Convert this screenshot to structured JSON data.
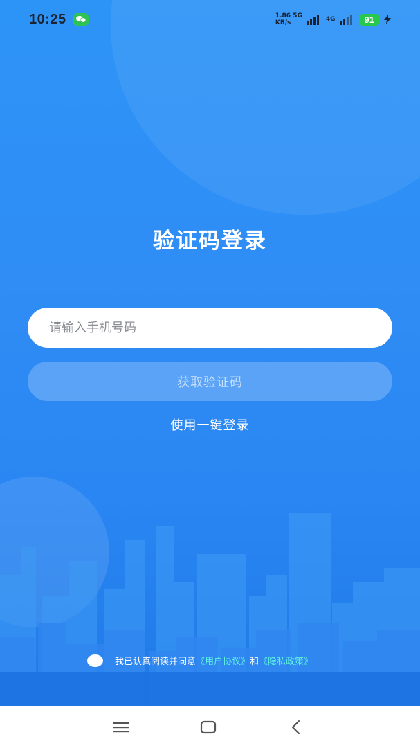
{
  "status_bar": {
    "time": "10:25",
    "net_speed_value": "1.86",
    "net_speed_unit": "KB/s",
    "net_type_1": "5G",
    "net_type_2": "4G",
    "battery": "91"
  },
  "login": {
    "title": "验证码登录",
    "phone_placeholder": "请输入手机号码",
    "get_code_label": "获取验证码",
    "one_key_login_label": "使用一键登录"
  },
  "agreement": {
    "prefix": "我已认真阅读并同意",
    "user_agreement": "《用户协议》",
    "conjunction": "和",
    "privacy_policy": "《隐私政策》"
  },
  "colors": {
    "background": "#2d94f7",
    "link": "#5ef2e2",
    "battery": "#27c84b"
  },
  "icons": {
    "status_app": "wechat-icon",
    "nav": [
      "menu-icon",
      "home-icon",
      "back-icon"
    ]
  }
}
